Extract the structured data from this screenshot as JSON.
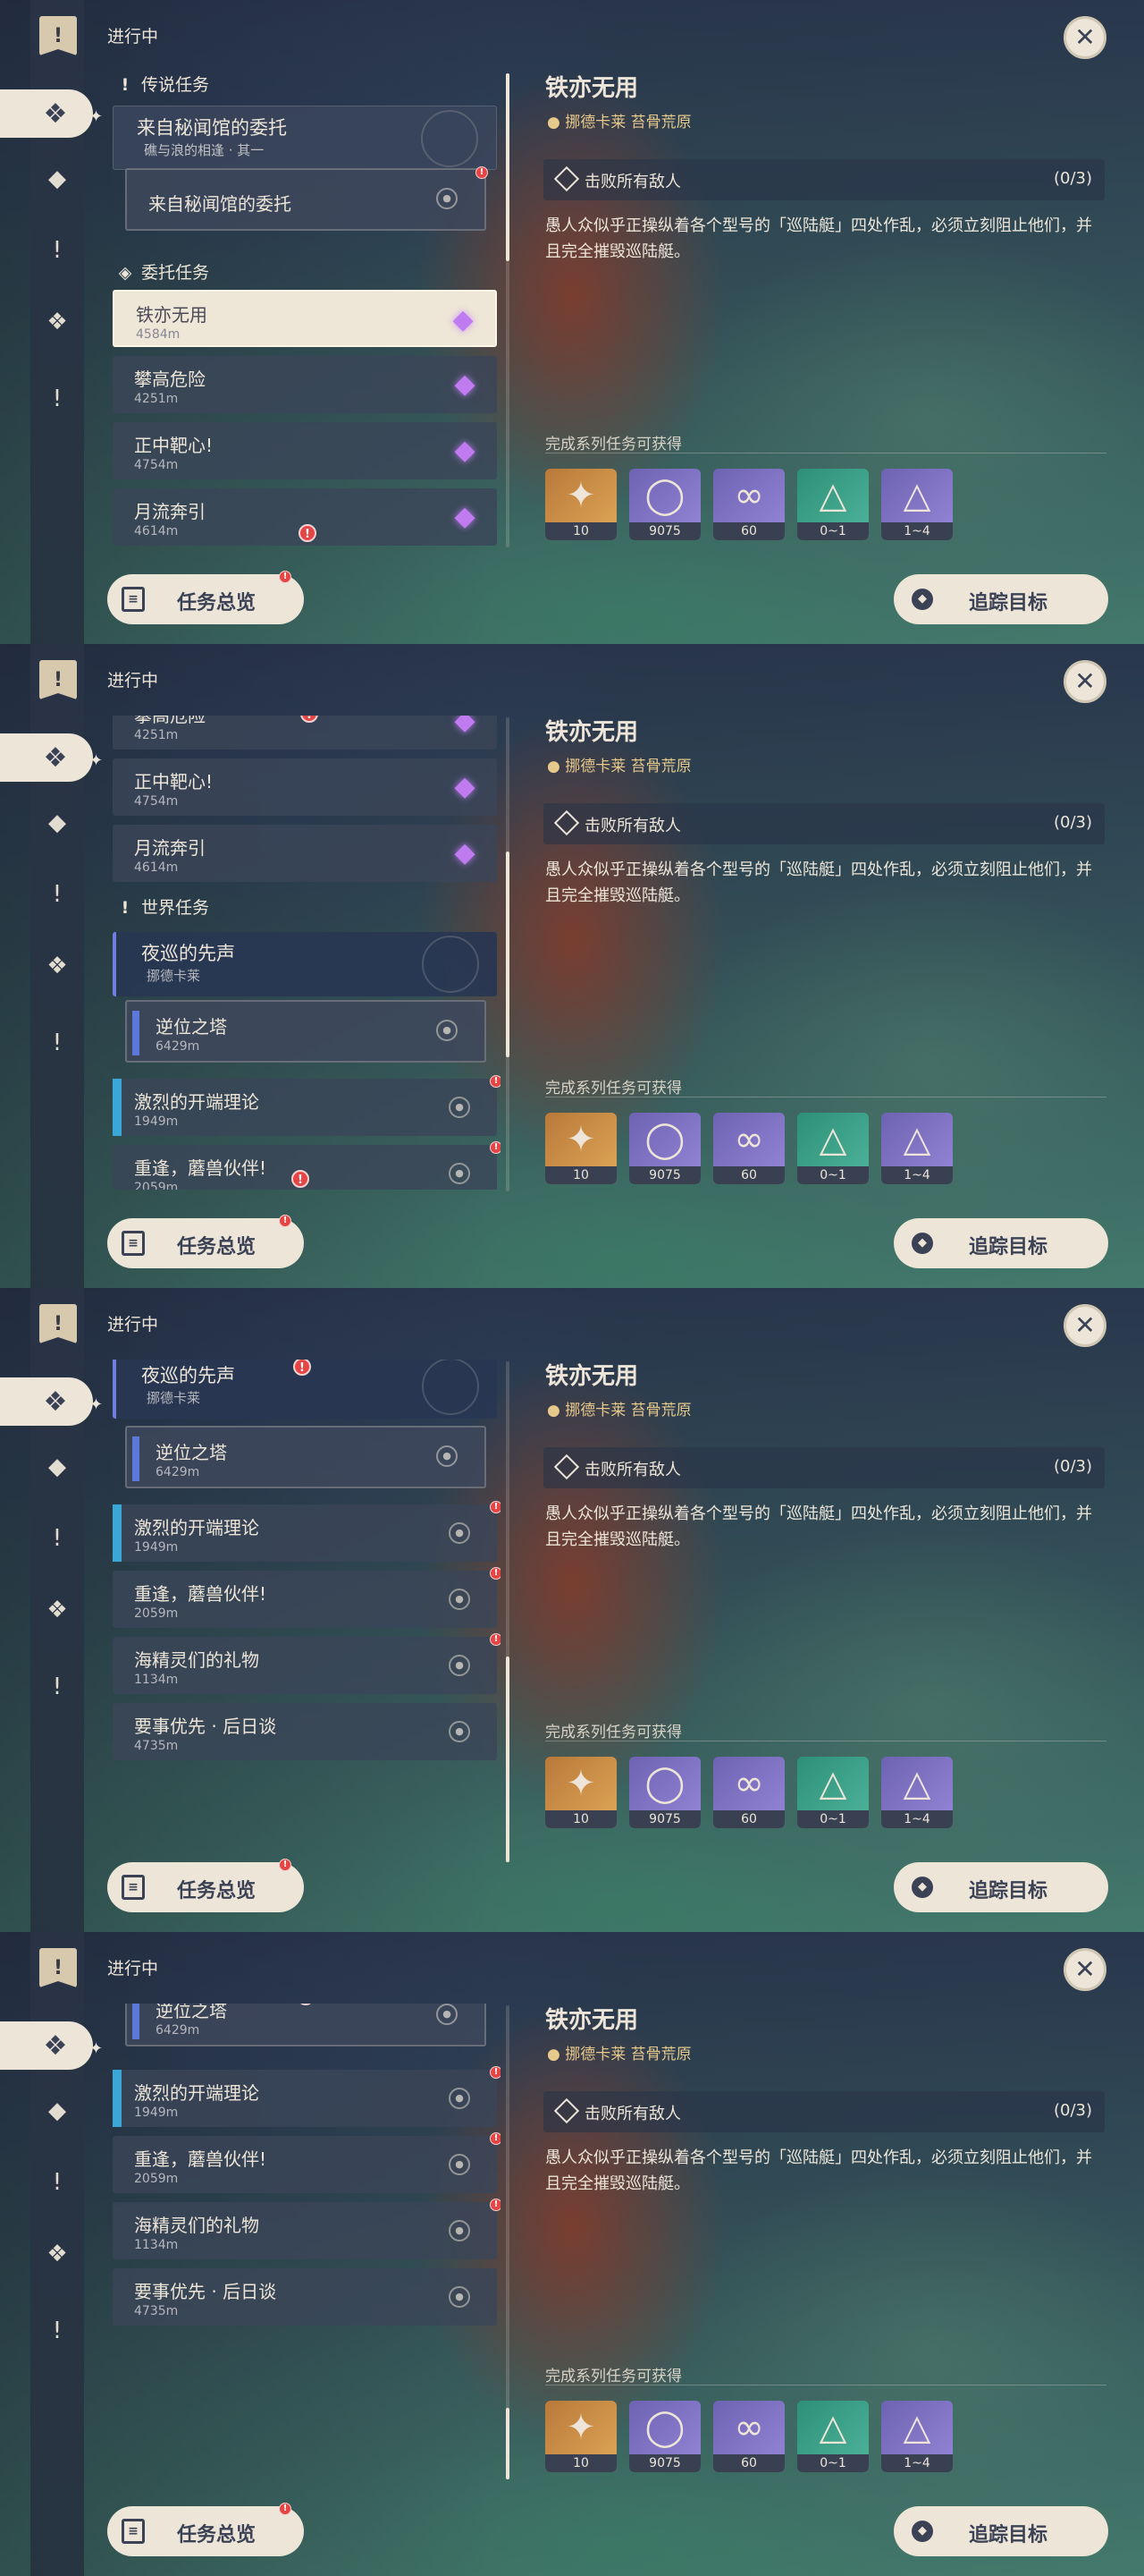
{
  "header": {
    "in_progress": "进行中",
    "flag_icon": "exclamation-flag-icon",
    "close_icon": "close-icon"
  },
  "rail": {
    "icons": [
      "all-quests-icon",
      "archon-quest-icon",
      "story-quest-icon",
      "commission-quest-icon",
      "world-quest-icon"
    ]
  },
  "sections": {
    "legend": "传说任务",
    "commission": "委托任务",
    "world": "世界任务"
  },
  "quests": {
    "legend_group": {
      "name": "来自秘闻馆的委托",
      "desc": "礁与浪的相逢 · 其一"
    },
    "legend_sub": {
      "name": "来自秘闻馆的委托"
    },
    "commissions": [
      {
        "name": "铁亦无用",
        "dist": "4584m"
      },
      {
        "name": "攀高危险",
        "dist": "4251m"
      },
      {
        "name": "正中靶心!",
        "dist": "4754m"
      },
      {
        "name": "月流奔引",
        "dist": "4614m"
      }
    ],
    "world_group": {
      "name": "夜巡的先声",
      "desc": "挪德卡莱"
    },
    "world_sub": {
      "name": "逆位之塔",
      "dist": "6429m"
    },
    "world": [
      {
        "name": "激烈的开端理论",
        "dist": "1949m"
      },
      {
        "name": "重逢，蘑兽伙伴!",
        "dist": "2059m"
      },
      {
        "name": "海精灵们的礼物",
        "dist": "1134m"
      },
      {
        "name": "要事优先 · 后日谈",
        "dist": "4735m"
      }
    ]
  },
  "detail": {
    "title": "铁亦无用",
    "location": "挪德卡莱 苔骨荒原",
    "objective": "击败所有敌人",
    "objective_count": "(0/3)",
    "description": "愚人众似乎正操纵着各个型号的「巡陆艇」四处作乱，必须立刻阻止他们，并且完全摧毁巡陆艇。",
    "rewards_label": "完成系列任务可获得",
    "rewards": [
      {
        "icon": "primogem-icon",
        "count": "10"
      },
      {
        "icon": "mora-icon",
        "count": "9075"
      },
      {
        "icon": "adventure-exp-icon",
        "count": "60"
      },
      {
        "icon": "crystal-ore-icon",
        "count": "0~1"
      },
      {
        "icon": "crystal-cluster-icon",
        "count": "1~4"
      }
    ]
  },
  "buttons": {
    "overview": "任务总览",
    "track": "追踪目标"
  },
  "colors": {
    "cream": "#ece5d8",
    "dark": "#3b4255",
    "alert": "#e64545",
    "commission_purple": "#c07bf0",
    "world_blue": "#3aa7d6",
    "location_gold": "#e8c98c"
  }
}
